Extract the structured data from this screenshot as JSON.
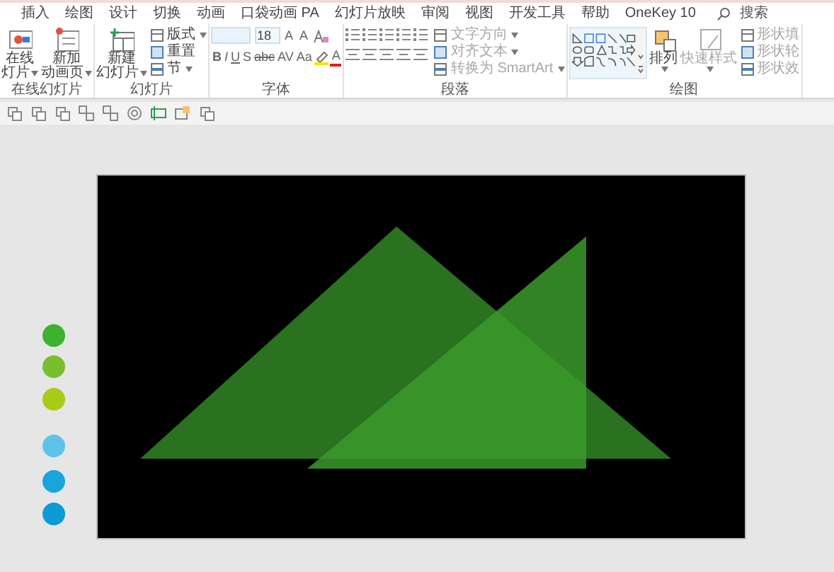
{
  "tabs": [
    {
      "label": "插入",
      "selected": false
    },
    {
      "label": "绘图",
      "selected": false
    },
    {
      "label": "设计",
      "selected": false
    },
    {
      "label": "切换",
      "selected": false
    },
    {
      "label": "动画",
      "selected": false
    },
    {
      "label": "口袋动画 PA",
      "selected": false
    },
    {
      "label": "幻灯片放映",
      "selected": false
    },
    {
      "label": "审阅",
      "selected": false
    },
    {
      "label": "视图",
      "selected": false
    },
    {
      "label": "开发工具",
      "selected": false
    },
    {
      "label": "帮助",
      "selected": false
    },
    {
      "label": "OneKey 10",
      "selected": false
    }
  ],
  "search": {
    "placeholder": "搜索"
  },
  "ribbon_groups": [
    {
      "kind": "buttons",
      "label": "在线幻灯片",
      "large": [
        {
          "lines": [
            "在线",
            "灯片"
          ],
          "dropdown": true,
          "disabled": false
        },
        {
          "lines": [
            "新加",
            "动画页"
          ],
          "dropdown": true,
          "disabled": false
        }
      ]
    },
    {
      "kind": "buttons",
      "label": "幻灯片",
      "large": [
        {
          "lines": [
            "新建",
            "幻灯片"
          ],
          "dropdown": true,
          "disabled": false
        }
      ],
      "small": [
        {
          "label": "版式",
          "dropdown": true,
          "disabled": false
        },
        {
          "label": "重置",
          "dropdown": false,
          "disabled": false
        },
        {
          "label": "节",
          "dropdown": true,
          "disabled": false
        }
      ]
    },
    {
      "kind": "font",
      "label": "字体",
      "font_size": "18",
      "size_buttons": [
        "A",
        "A"
      ],
      "format_buttons": [
        "B",
        "I",
        "U",
        "S",
        "abc",
        "AV",
        "Aa"
      ],
      "color_button": "A"
    },
    {
      "kind": "paragraph",
      "label": "段落",
      "small": [
        {
          "label": "文字方向",
          "dropdown": true,
          "disabled": true
        },
        {
          "label": "对齐文本",
          "dropdown": true,
          "disabled": true
        },
        {
          "label": "转换为 SmartArt",
          "dropdown": true,
          "disabled": true
        }
      ]
    },
    {
      "kind": "drawing",
      "label": "绘图",
      "large": [
        {
          "lines": [
            "排列"
          ],
          "dropdown": true,
          "disabled": false
        },
        {
          "lines": [
            "快速样式"
          ],
          "dropdown": true,
          "disabled": true
        }
      ],
      "small": [
        {
          "label": "形状填",
          "dropdown": false,
          "disabled": true
        },
        {
          "label": "形状轮",
          "dropdown": false,
          "disabled": true
        },
        {
          "label": "形状效",
          "dropdown": false,
          "disabled": true
        }
      ]
    }
  ],
  "dots": [
    {
      "color": "#3cb22e"
    },
    {
      "color": "#78bf2c"
    },
    {
      "color": "#a7cc18"
    },
    {
      "color": "#5ec3ea"
    },
    {
      "color": "#1aa4dd"
    },
    {
      "color": "#0c9bd7"
    }
  ]
}
